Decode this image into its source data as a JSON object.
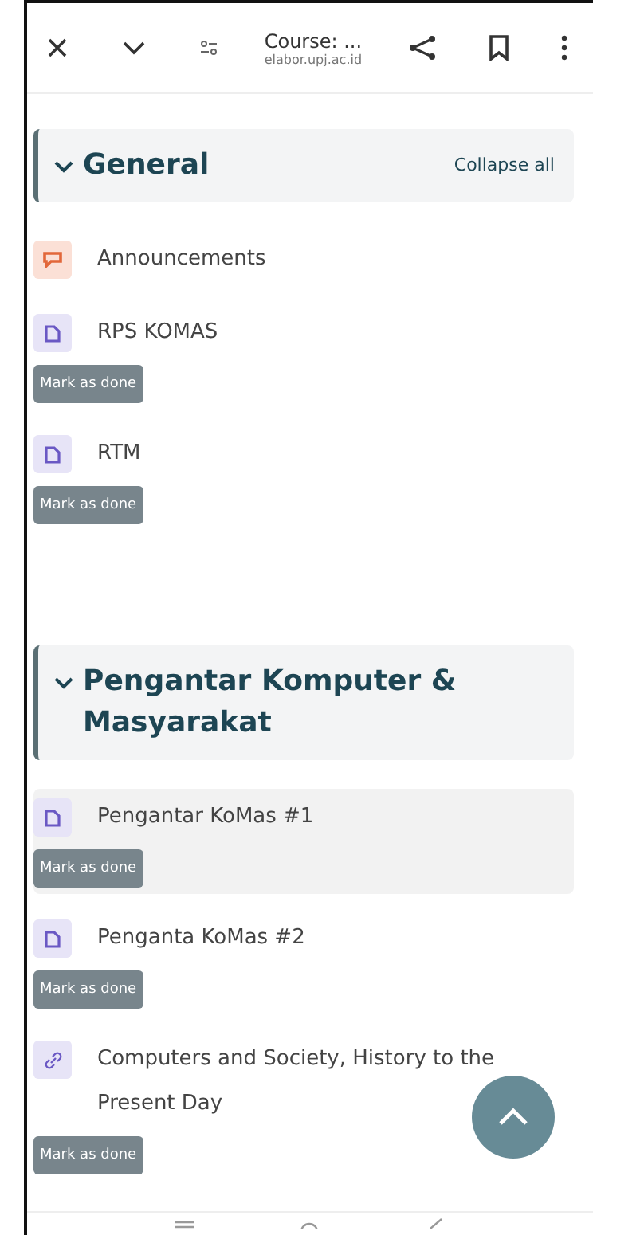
{
  "browser_bar": {
    "title": "Course: ...",
    "url": "elabor.upj.ac.id"
  },
  "sections": [
    {
      "title": "General",
      "expanded": true,
      "action": "Collapse all",
      "items": [
        {
          "kind": "forum",
          "title": "Announcements",
          "highlighted": false
        },
        {
          "kind": "file",
          "title": "RPS KOMAS",
          "button": "Mark as done",
          "highlighted": false
        },
        {
          "kind": "file",
          "title": "RTM",
          "button": "Mark as done",
          "highlighted": false
        }
      ]
    },
    {
      "title": "Pengantar Komputer & Masyarakat",
      "expanded": true,
      "items": [
        {
          "kind": "file",
          "title": "Pengantar KoMas #1",
          "button": "Mark as done",
          "highlighted": true
        },
        {
          "kind": "file",
          "title": "Penganta KoMas #2",
          "button": "Mark as done",
          "highlighted": false
        },
        {
          "kind": "url",
          "title": "Computers and Society, History to the Present Day",
          "button": "Mark as done",
          "highlighted": false
        }
      ]
    }
  ]
}
